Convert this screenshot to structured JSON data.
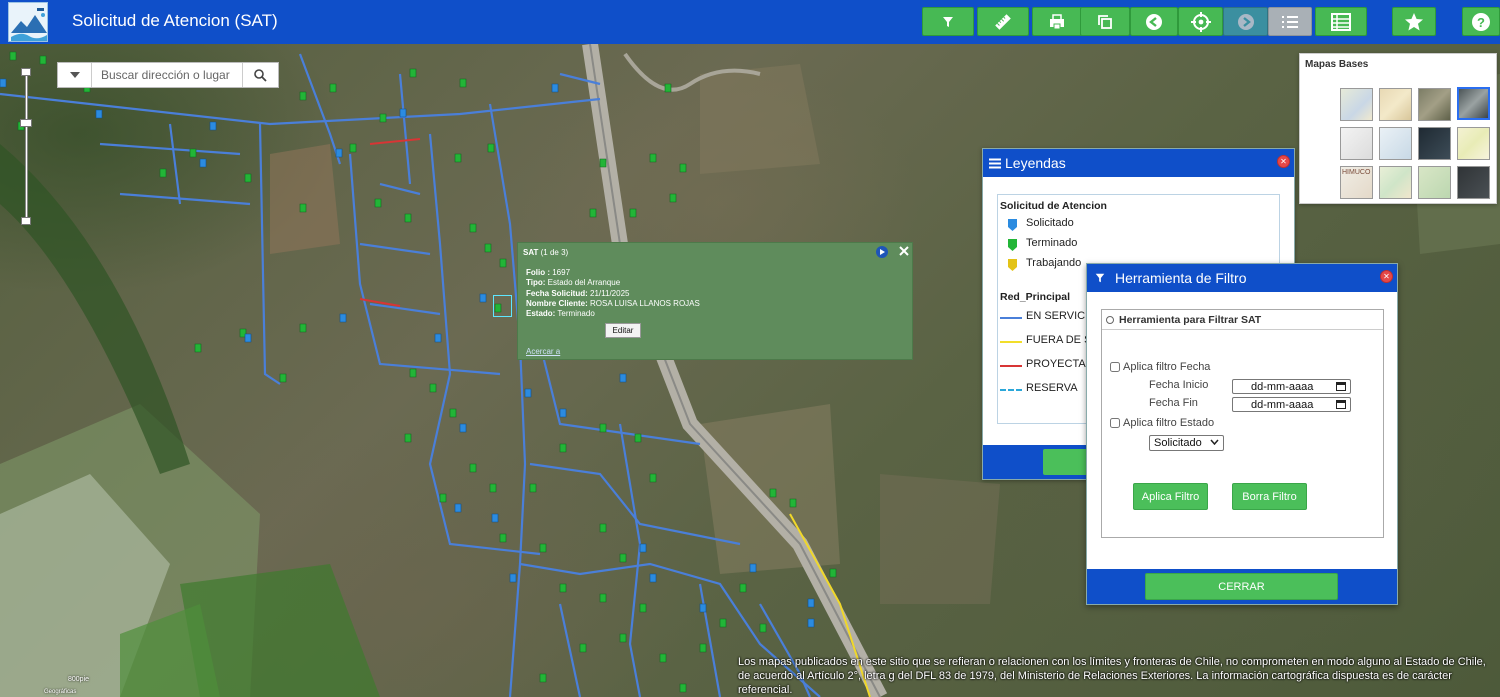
{
  "header": {
    "title": "Solicitud de Atencion (SAT)",
    "toolbar": [
      {
        "icon": "filter-icon"
      },
      {
        "icon": "ruler-icon"
      },
      {
        "icon": "print-icon"
      },
      {
        "icon": "copy-icon"
      },
      {
        "icon": "back-icon"
      },
      {
        "icon": "locate-icon"
      },
      {
        "icon": "forward-icon"
      },
      {
        "icon": "list-icon"
      },
      {
        "icon": "table-icon"
      },
      {
        "icon": "star-icon"
      },
      {
        "icon": "help-icon"
      }
    ]
  },
  "search": {
    "placeholder": "Buscar dirección o lugar"
  },
  "popup": {
    "title": "SAT",
    "counter": "(1 de 3)",
    "fields": [
      {
        "label": "Folio :",
        "value": "1697"
      },
      {
        "label": "Tipo:",
        "value": "Estado del Arranque"
      },
      {
        "label": "Fecha Solicitud:",
        "value": "21/11/2025"
      },
      {
        "label": "Nombre Cliente:",
        "value": "ROSA LUISA LLANOS ROJAS"
      },
      {
        "label": "Estado:",
        "value": "Terminado"
      }
    ],
    "edit_label": "Editar",
    "zoom_label": "Acercar a"
  },
  "basemaps": {
    "title": "Mapas Bases",
    "thumb_labels": [
      "HIMUCO"
    ]
  },
  "legend": {
    "title": "Leyendas",
    "section1": "Solicitud de Atencion",
    "items1": [
      {
        "label": "Solicitado",
        "color": "#2b8be0"
      },
      {
        "label": "Terminado",
        "color": "#22b537"
      },
      {
        "label": "Trabajando",
        "color": "#e3c317"
      }
    ],
    "section2": "Red_Principal",
    "items2": [
      {
        "label": "EN SERVICIO",
        "color": "#4a7fd9"
      },
      {
        "label": "FUERA DE SERVICIO",
        "color": "#f2de2a"
      },
      {
        "label": "PROYECTADO",
        "color": "#d83535"
      },
      {
        "label": "RESERVA",
        "color": "#2ba7d9"
      }
    ]
  },
  "filter": {
    "title": "Herramienta de Filtro",
    "section": "Herramienta para Filtrar SAT",
    "chk_fecha": "Aplica filtro Fecha",
    "fecha_inicio_label": "Fecha Inicio",
    "fecha_fin_label": "Fecha Fin",
    "date_placeholder": "dd-mm-aaaa",
    "chk_estado": "Aplica filtro Estado",
    "estado_value": "Solicitado",
    "apply_label": "Aplica Filtro",
    "clear_label": "Borra Filtro",
    "close_label": "CERRAR"
  },
  "map": {
    "scale_label": "800pie",
    "attribution": "Geográficas",
    "disclaimer": "Los mapas publicados en este sitio que se refieran o relacionen con los límites y fronteras de Chile, no comprometen en modo alguno al Estado de Chile, de acuerdo al Artículo 2°, letra g del DFL 83 de 1979, del Ministerio de Relaciones Exteriores. La información cartográfica dispuesta es de carácter referencial."
  }
}
